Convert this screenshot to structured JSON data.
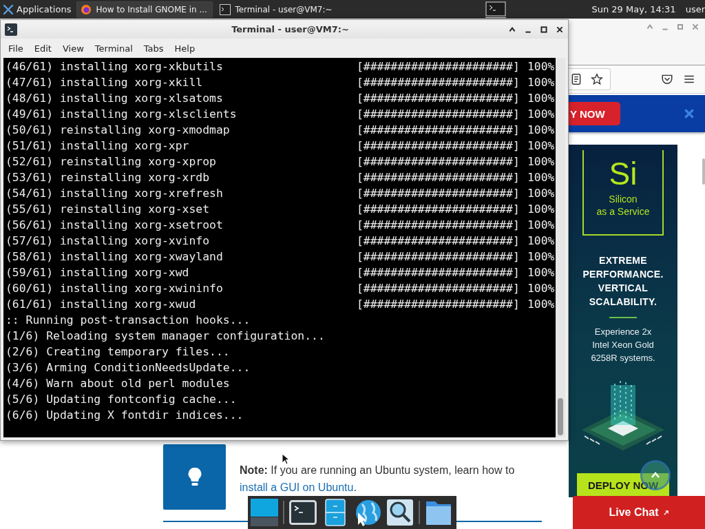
{
  "panel": {
    "applications": "Applications",
    "tasks": [
      {
        "kind": "browser",
        "label": "How to Install GNOME in ...",
        "selected": true
      },
      {
        "kind": "terminal",
        "label": "Terminal - user@VM7:~",
        "selected": false
      }
    ],
    "clock": "Sun 29 May, 14:31",
    "user": "user"
  },
  "terminal": {
    "title": "Terminal - user@VM7:~",
    "menu": [
      "File",
      "Edit",
      "View",
      "Terminal",
      "Tabs",
      "Help"
    ],
    "lines": [
      {
        "kind": "progress",
        "text": "(46/61) installing xorg-xkbutils",
        "bar": "[######################]",
        "percent": "100%"
      },
      {
        "kind": "progress",
        "text": "(47/61) installing xorg-xkill",
        "bar": "[######################]",
        "percent": "100%"
      },
      {
        "kind": "progress",
        "text": "(48/61) installing xorg-xlsatoms",
        "bar": "[######################]",
        "percent": "100%"
      },
      {
        "kind": "progress",
        "text": "(49/61) installing xorg-xlsclients",
        "bar": "[######################]",
        "percent": "100%"
      },
      {
        "kind": "progress",
        "text": "(50/61) reinstalling xorg-xmodmap",
        "bar": "[######################]",
        "percent": "100%"
      },
      {
        "kind": "progress",
        "text": "(51/61) installing xorg-xpr",
        "bar": "[######################]",
        "percent": "100%"
      },
      {
        "kind": "progress",
        "text": "(52/61) reinstalling xorg-xprop",
        "bar": "[######################]",
        "percent": "100%"
      },
      {
        "kind": "progress",
        "text": "(53/61) reinstalling xorg-xrdb",
        "bar": "[######################]",
        "percent": "100%"
      },
      {
        "kind": "progress",
        "text": "(54/61) installing xorg-xrefresh",
        "bar": "[######################]",
        "percent": "100%"
      },
      {
        "kind": "progress",
        "text": "(55/61) reinstalling xorg-xset",
        "bar": "[######################]",
        "percent": "100%"
      },
      {
        "kind": "progress",
        "text": "(56/61) installing xorg-xsetroot",
        "bar": "[######################]",
        "percent": "100%"
      },
      {
        "kind": "progress",
        "text": "(57/61) installing xorg-xvinfo",
        "bar": "[######################]",
        "percent": "100%"
      },
      {
        "kind": "progress",
        "text": "(58/61) installing xorg-xwayland",
        "bar": "[######################]",
        "percent": "100%"
      },
      {
        "kind": "progress",
        "text": "(59/61) installing xorg-xwd",
        "bar": "[######################]",
        "percent": "100%"
      },
      {
        "kind": "progress",
        "text": "(60/61) installing xorg-xwininfo",
        "bar": "[######################]",
        "percent": "100%"
      },
      {
        "kind": "progress",
        "text": "(61/61) installing xorg-xwud",
        "bar": "[######################]",
        "percent": "100%"
      },
      {
        "kind": "plain",
        "text": ":: Running post-transaction hooks..."
      },
      {
        "kind": "plain",
        "text": "(1/6) Reloading system manager configuration..."
      },
      {
        "kind": "plain",
        "text": "(2/6) Creating temporary files..."
      },
      {
        "kind": "plain",
        "text": "(3/6) Arming ConditionNeedsUpdate..."
      },
      {
        "kind": "plain",
        "text": "(4/6) Warn about old perl modules"
      },
      {
        "kind": "plain",
        "text": "(5/6) Updating fontconfig cache..."
      },
      {
        "kind": "plain",
        "text": "(6/6) Updating X fontdir indices..."
      }
    ]
  },
  "browser": {
    "banner_button": "Y NOW",
    "ad": {
      "logo": "Si",
      "tagline": [
        "Silicon",
        "as a Service"
      ],
      "headline": [
        "EXTREME",
        "PERFORMANCE.",
        "VERTICAL",
        "SCALABILITY."
      ],
      "body": [
        "Experience 2x",
        "Intel Xeon Gold",
        "6258R systems."
      ],
      "cta": "DEPLOY NOW"
    },
    "live_chat": "Live Chat",
    "note": {
      "text": "**Note:** If you are running an Ubuntu system, learn how to",
      "link": "install a GUI on Ubuntu",
      "end": "."
    }
  }
}
